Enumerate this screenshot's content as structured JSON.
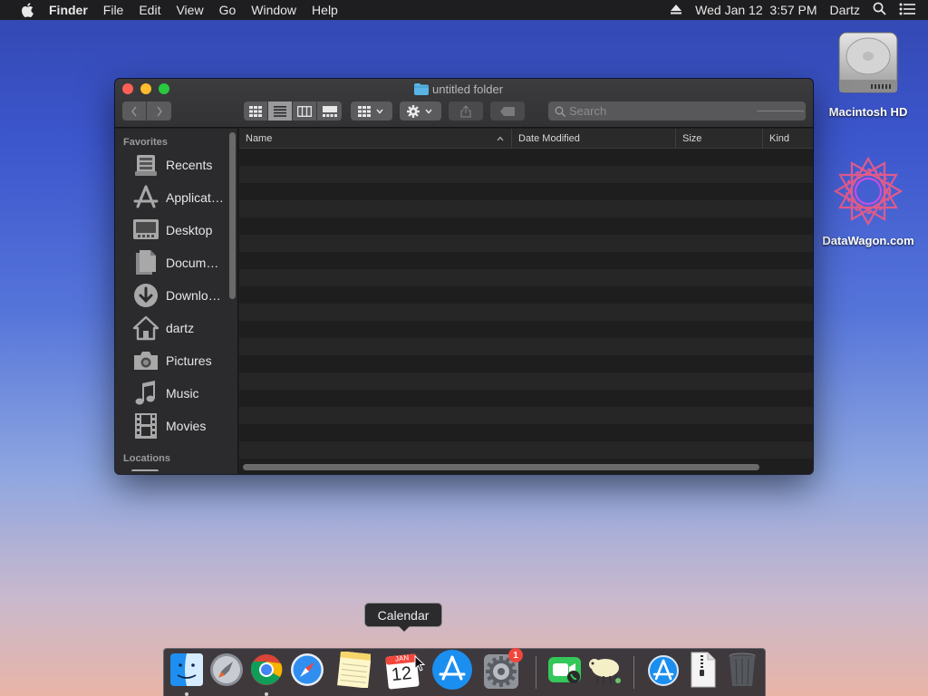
{
  "menubar": {
    "app_name": "Finder",
    "items": [
      "File",
      "Edit",
      "View",
      "Go",
      "Window",
      "Help"
    ],
    "datetime": "Wed Jan 12  3:57 PM",
    "user": "Dartz"
  },
  "desktop": {
    "icons": [
      {
        "label": "Macintosh HD",
        "icon": "hard-drive-icon"
      },
      {
        "label": "DataWagon.com",
        "icon": "datawagon-logo-icon"
      }
    ]
  },
  "window": {
    "title": "untitled folder",
    "search_placeholder": "Search",
    "view_mode": "list",
    "sidebar": {
      "favorites_header": "Favorites",
      "locations_header": "Locations",
      "items": [
        {
          "label": "Recents",
          "icon": "recents-icon"
        },
        {
          "label": "Applications",
          "icon": "applications-icon"
        },
        {
          "label": "Desktop",
          "icon": "desktop-icon"
        },
        {
          "label": "Documents",
          "icon": "documents-icon"
        },
        {
          "label": "Downloads",
          "icon": "downloads-icon"
        },
        {
          "label": "dartz",
          "icon": "home-icon"
        },
        {
          "label": "Pictures",
          "icon": "pictures-icon"
        },
        {
          "label": "Music",
          "icon": "music-icon"
        },
        {
          "label": "Movies",
          "icon": "movies-icon"
        }
      ]
    },
    "columns": [
      "Name",
      "Date Modified",
      "Size",
      "Kind"
    ],
    "rows": []
  },
  "tooltip": {
    "text": "Calendar"
  },
  "dock": {
    "apps": [
      {
        "name": "Finder",
        "icon": "finder-icon",
        "running": true
      },
      {
        "name": "Launchpad",
        "icon": "launchpad-icon",
        "running": false
      },
      {
        "name": "Chrome",
        "icon": "chrome-icon",
        "running": true
      },
      {
        "name": "Safari",
        "icon": "safari-icon",
        "running": false
      },
      {
        "name": "Notes",
        "icon": "notes-icon",
        "running": false
      },
      {
        "name": "Calendar",
        "icon": "calendar-icon",
        "running": false,
        "month": "JAN",
        "day": "12"
      },
      {
        "name": "App Store",
        "icon": "app-store-icon",
        "running": false
      },
      {
        "name": "System Preferences",
        "icon": "system-preferences-icon",
        "running": false,
        "badge": "1"
      },
      {
        "name": "FaceTime",
        "icon": "facetime-icon",
        "running": false
      },
      {
        "name": "Sheep",
        "icon": "sheep-icon",
        "running": false
      },
      {
        "name": "App Store Downloads",
        "icon": "app-store-folder-icon",
        "running": false
      },
      {
        "name": "Archive",
        "icon": "zip-file-icon",
        "running": false
      },
      {
        "name": "Trash",
        "icon": "trash-icon",
        "running": false
      }
    ]
  },
  "colors": {
    "window_bg": "#1f1f1f",
    "accent_folder": "#5ab4e6",
    "badge": "#f2463c"
  }
}
